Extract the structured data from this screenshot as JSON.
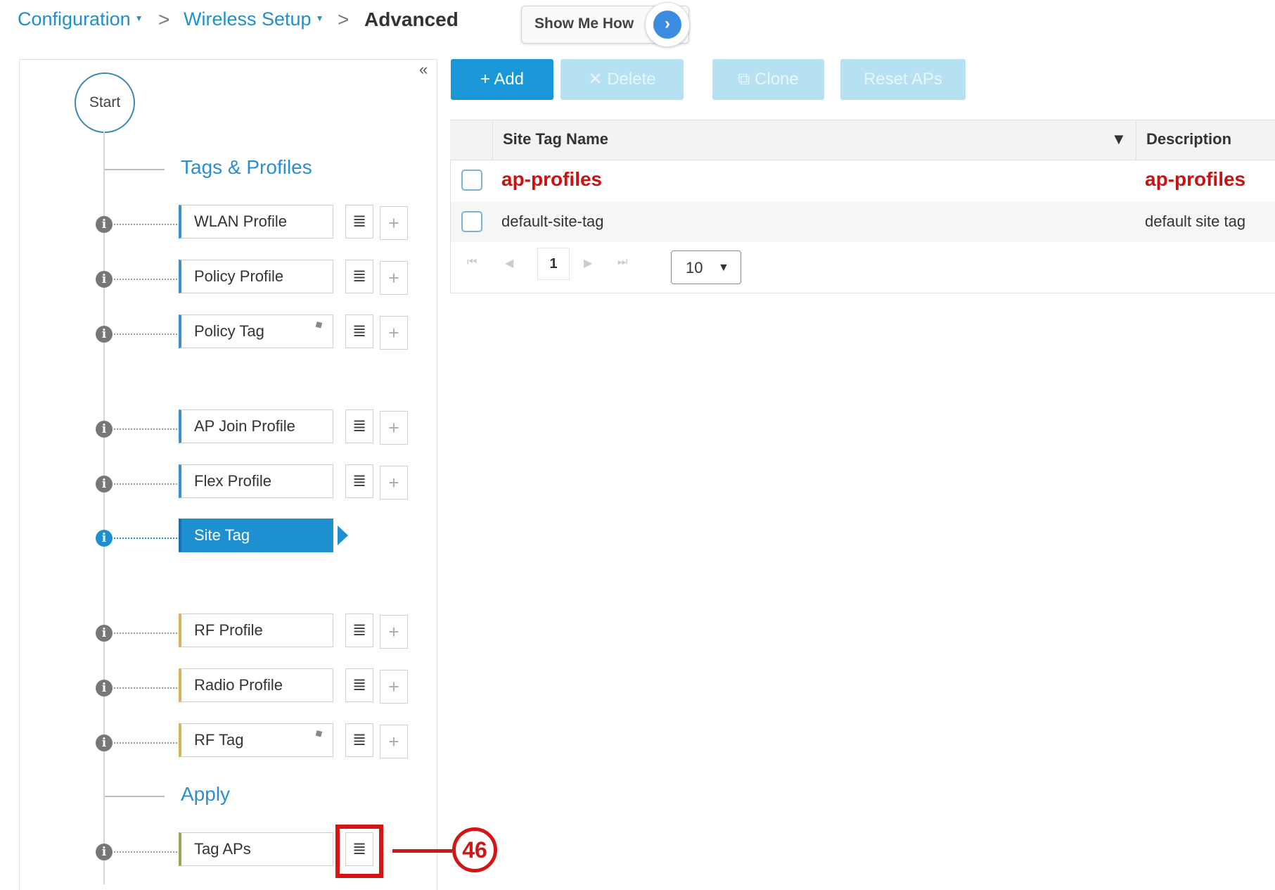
{
  "breadcrumb": {
    "configuration": "Configuration",
    "wireless_setup": "Wireless Setup",
    "current": "Advanced",
    "separator": ">"
  },
  "show_me_how": "Show Me How",
  "show_me_how_glyph": "›",
  "collapse_glyph": "«",
  "flow": {
    "start": "Start",
    "sections": {
      "tags_profiles": "Tags & Profiles",
      "apply": "Apply"
    },
    "items": [
      {
        "label": "WLAN Profile"
      },
      {
        "label": "Policy Profile"
      },
      {
        "label": "Policy Tag"
      },
      {
        "label": "AP Join Profile"
      },
      {
        "label": "Flex Profile"
      },
      {
        "label": "Site Tag"
      },
      {
        "label": "RF Profile"
      },
      {
        "label": "Radio Profile"
      },
      {
        "label": "RF Tag"
      },
      {
        "label": "Tag APs"
      }
    ],
    "active_item": "Site Tag"
  },
  "icons": {
    "info": "i",
    "list": "≣",
    "plus": "+",
    "tag": "⬥",
    "filter": "▼"
  },
  "toolbar": {
    "add": "+ Add",
    "delete": "✕ Delete",
    "clone": "⧉ Clone",
    "reset": "Reset APs"
  },
  "table": {
    "columns": [
      "Site Tag Name",
      "Description"
    ],
    "rows": [
      {
        "name": "ap-profiles",
        "description": "ap-profiles"
      },
      {
        "name": "default-site-tag",
        "description": "default site tag"
      }
    ]
  },
  "pagination": {
    "first": "⏮",
    "prev": "◀",
    "page": "1",
    "next": "▶",
    "last": "⏭",
    "page_size": "10"
  },
  "callout": "46",
  "colors": {
    "accent": "#1e8fd0",
    "highlight": "#cc1111"
  }
}
